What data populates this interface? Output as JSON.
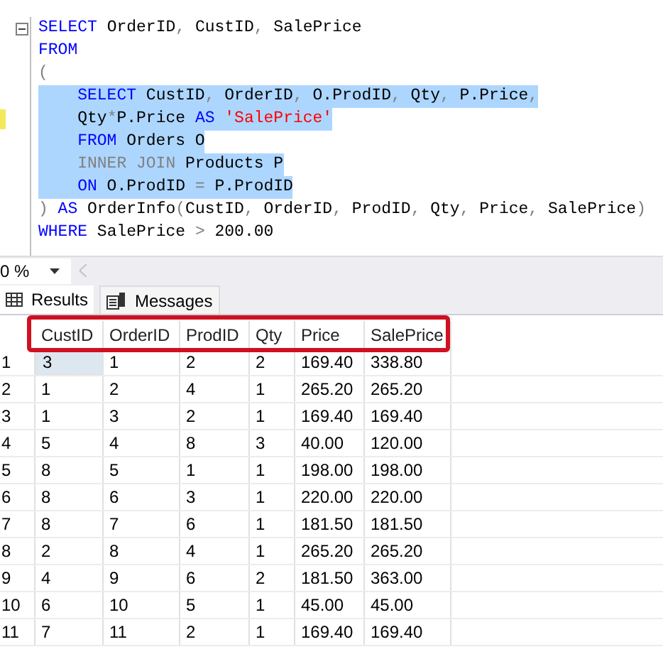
{
  "editor": {
    "fold_marker": true,
    "lines": [
      {
        "selected": false,
        "changed": false,
        "indented": false,
        "segments": [
          {
            "kind": "keyword",
            "text": "SELECT"
          },
          {
            "kind": "text",
            "text": " OrderID"
          },
          {
            "kind": "operator",
            "text": ","
          },
          {
            "kind": "text",
            "text": " CustID"
          },
          {
            "kind": "operator",
            "text": ","
          },
          {
            "kind": "text",
            "text": " SalePrice"
          }
        ]
      },
      {
        "selected": false,
        "changed": false,
        "indented": false,
        "segments": [
          {
            "kind": "keyword",
            "text": "FROM"
          }
        ]
      },
      {
        "selected": false,
        "changed": false,
        "indented": false,
        "segments": [
          {
            "kind": "operator",
            "text": "("
          }
        ]
      },
      {
        "selected": true,
        "changed": false,
        "indented": true,
        "segments": [
          {
            "kind": "keyword",
            "text": "SELECT"
          },
          {
            "kind": "text",
            "text": " CustID"
          },
          {
            "kind": "operator",
            "text": ","
          },
          {
            "kind": "text",
            "text": " OrderID"
          },
          {
            "kind": "operator",
            "text": ","
          },
          {
            "kind": "text",
            "text": " O.ProdID"
          },
          {
            "kind": "operator",
            "text": ","
          },
          {
            "kind": "text",
            "text": " Qty"
          },
          {
            "kind": "operator",
            "text": ","
          },
          {
            "kind": "text",
            "text": " P.Price"
          },
          {
            "kind": "operator",
            "text": ","
          }
        ]
      },
      {
        "selected": true,
        "changed": true,
        "indented": true,
        "segments": [
          {
            "kind": "text",
            "text": "Qty"
          },
          {
            "kind": "operator",
            "text": "*"
          },
          {
            "kind": "text",
            "text": "P.Price "
          },
          {
            "kind": "keyword",
            "text": "AS "
          },
          {
            "kind": "string",
            "text": "'SalePrice'"
          }
        ]
      },
      {
        "selected": true,
        "changed": false,
        "indented": true,
        "segments": [
          {
            "kind": "keyword",
            "text": "FROM"
          },
          {
            "kind": "text",
            "text": " Orders O"
          }
        ]
      },
      {
        "selected": true,
        "changed": false,
        "indented": true,
        "segments": [
          {
            "kind": "operator",
            "text": "INNER JOIN"
          },
          {
            "kind": "text",
            "text": " Products P"
          }
        ]
      },
      {
        "selected": true,
        "changed": false,
        "indented": true,
        "segments": [
          {
            "kind": "keyword",
            "text": "ON"
          },
          {
            "kind": "text",
            "text": " O.ProdID "
          },
          {
            "kind": "operator",
            "text": "="
          },
          {
            "kind": "text",
            "text": " P.ProdID"
          }
        ]
      },
      {
        "selected": false,
        "changed": false,
        "indented": false,
        "segments": [
          {
            "kind": "operator",
            "text": ")"
          },
          {
            "kind": "keyword",
            "text": " AS"
          },
          {
            "kind": "text",
            "text": " OrderInfo"
          },
          {
            "kind": "operator",
            "text": "("
          },
          {
            "kind": "text",
            "text": "CustID"
          },
          {
            "kind": "operator",
            "text": ","
          },
          {
            "kind": "text",
            "text": " OrderID"
          },
          {
            "kind": "operator",
            "text": ","
          },
          {
            "kind": "text",
            "text": " ProdID"
          },
          {
            "kind": "operator",
            "text": ","
          },
          {
            "kind": "text",
            "text": " Qty"
          },
          {
            "kind": "operator",
            "text": ","
          },
          {
            "kind": "text",
            "text": " Price"
          },
          {
            "kind": "operator",
            "text": ","
          },
          {
            "kind": "text",
            "text": " SalePrice"
          },
          {
            "kind": "operator",
            "text": ")"
          }
        ]
      },
      {
        "selected": false,
        "changed": false,
        "indented": false,
        "segments": [
          {
            "kind": "keyword",
            "text": "WHERE"
          },
          {
            "kind": "text",
            "text": " SalePrice "
          },
          {
            "kind": "operator",
            "text": ">"
          },
          {
            "kind": "text",
            "text": " 200.00"
          }
        ]
      }
    ]
  },
  "zoom": {
    "value": "0 %"
  },
  "tabs": [
    {
      "label": "Results",
      "selected": true
    },
    {
      "label": "Messages",
      "selected": false
    }
  ],
  "grid": {
    "highlight_header": true,
    "columns": [
      "CustID",
      "OrderID",
      "ProdID",
      "Qty",
      "Price",
      "SalePrice"
    ],
    "rows": [
      {
        "number": "1",
        "selected": true,
        "cells": [
          "3",
          "1",
          "2",
          "2",
          "169.40",
          "338.80"
        ]
      },
      {
        "number": "2",
        "selected": false,
        "cells": [
          "1",
          "2",
          "4",
          "1",
          "265.20",
          "265.20"
        ]
      },
      {
        "number": "3",
        "selected": false,
        "cells": [
          "1",
          "3",
          "2",
          "1",
          "169.40",
          "169.40"
        ]
      },
      {
        "number": "4",
        "selected": false,
        "cells": [
          "5",
          "4",
          "8",
          "3",
          "40.00",
          "120.00"
        ]
      },
      {
        "number": "5",
        "selected": false,
        "cells": [
          "8",
          "5",
          "1",
          "1",
          "198.00",
          "198.00"
        ]
      },
      {
        "number": "6",
        "selected": false,
        "cells": [
          "8",
          "6",
          "3",
          "1",
          "220.00",
          "220.00"
        ]
      },
      {
        "number": "7",
        "selected": false,
        "cells": [
          "8",
          "7",
          "6",
          "1",
          "181.50",
          "181.50"
        ]
      },
      {
        "number": "8",
        "selected": false,
        "cells": [
          "2",
          "8",
          "4",
          "1",
          "265.20",
          "265.20"
        ]
      },
      {
        "number": "9",
        "selected": false,
        "cells": [
          "4",
          "9",
          "6",
          "2",
          "181.50",
          "363.00"
        ]
      },
      {
        "number": "10",
        "selected": false,
        "cells": [
          "6",
          "10",
          "5",
          "1",
          "45.00",
          "45.00"
        ]
      },
      {
        "number": "11",
        "selected": false,
        "cells": [
          "7",
          "11",
          "2",
          "1",
          "169.40",
          "169.40"
        ]
      }
    ]
  }
}
